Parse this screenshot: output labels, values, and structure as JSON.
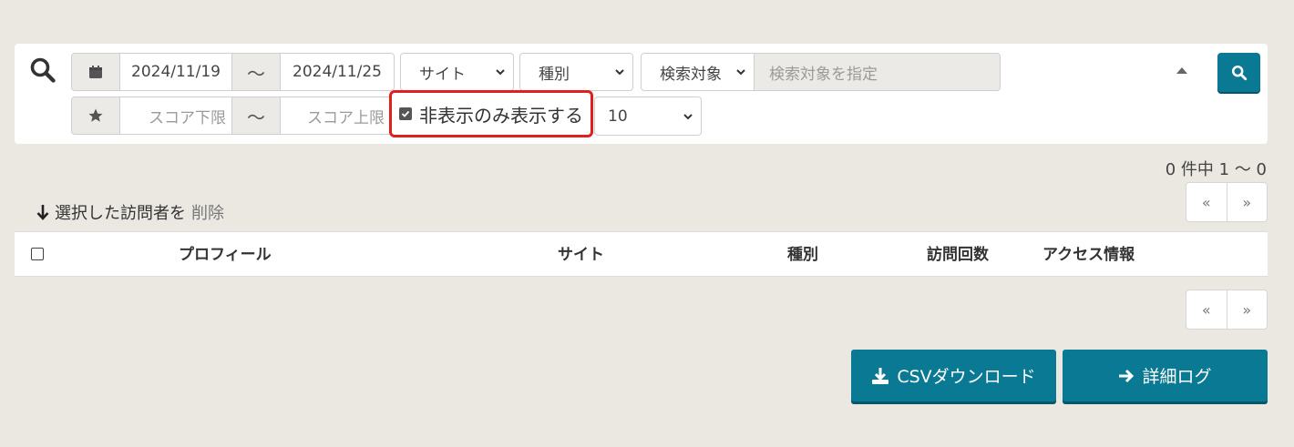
{
  "filters": {
    "date_from": "2024/11/19",
    "date_to": "2024/11/25",
    "tilde": "～",
    "site_select": "サイト",
    "type_select": "種別",
    "search_target_select": "検索対象",
    "search_target_placeholder": "検索対象を指定",
    "score_min_placeholder": "スコア下限",
    "score_max_placeholder": "スコア上限",
    "hidden_only_label": "非表示のみ表示する",
    "hidden_only_checked": true,
    "per_page": "10"
  },
  "pagination": {
    "count_text": "0 件中 1 ～ 0",
    "prev": "«",
    "next": "»"
  },
  "bulk": {
    "label": "選択した訪問者を",
    "delete": "削除"
  },
  "table": {
    "columns": [
      "プロフィール",
      "サイト",
      "種別",
      "訪問回数",
      "アクセス情報"
    ]
  },
  "actions": {
    "csv": "CSVダウンロード",
    "detail": "詳細ログ"
  },
  "colors": {
    "primary": "#0a7993",
    "highlight": "#e0201c",
    "background": "#ebe8e2"
  },
  "icons": {
    "search": "search-icon",
    "calendar": "calendar-icon",
    "star": "star-icon",
    "download": "download-icon",
    "arrow_right": "arrow-right-icon",
    "arrow_down": "arrow-down-icon"
  }
}
